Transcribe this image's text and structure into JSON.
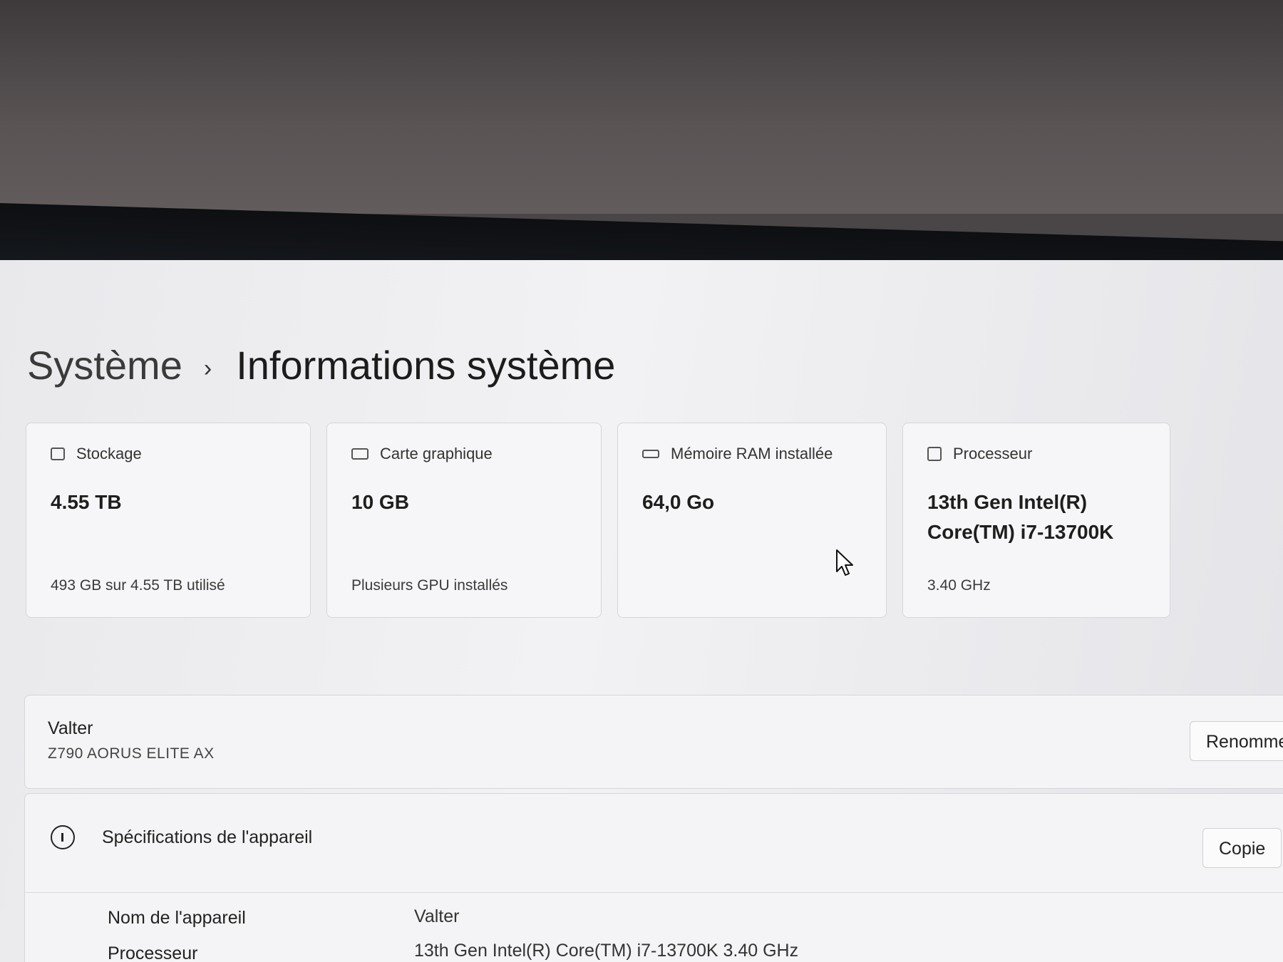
{
  "breadcrumb": {
    "parent": "Système",
    "separator": "›",
    "current": "Informations système"
  },
  "cards": [
    {
      "icon": "storage-icon",
      "label": "Stockage",
      "value": "4.55 TB",
      "sub": "493 GB sur 4.55 TB utilisé"
    },
    {
      "icon": "graphics-card-icon",
      "label": "Carte graphique",
      "value": "10 GB",
      "sub": "Plusieurs GPU installés"
    },
    {
      "icon": "ram-icon",
      "label": "Mémoire RAM installée",
      "value": "64,0 Go",
      "sub": ""
    },
    {
      "icon": "processor-icon",
      "label": "Processeur",
      "value_line1": "13th Gen Intel(R)",
      "value_line2": "Core(TM) i7-13700K",
      "sub": "3.40 GHz"
    }
  ],
  "device": {
    "name": "Valter",
    "model": "Z790 AORUS ELITE AX",
    "rename_button": "Renomme"
  },
  "specs": {
    "title": "Spécifications de l'appareil",
    "copy_button": "Copie",
    "rows": [
      {
        "label": "Nom de l'appareil",
        "value": "Valter"
      },
      {
        "label": "Processeur",
        "value": "13th Gen Intel(R) Core(TM) i7-13700K   3.40 GHz"
      }
    ]
  }
}
